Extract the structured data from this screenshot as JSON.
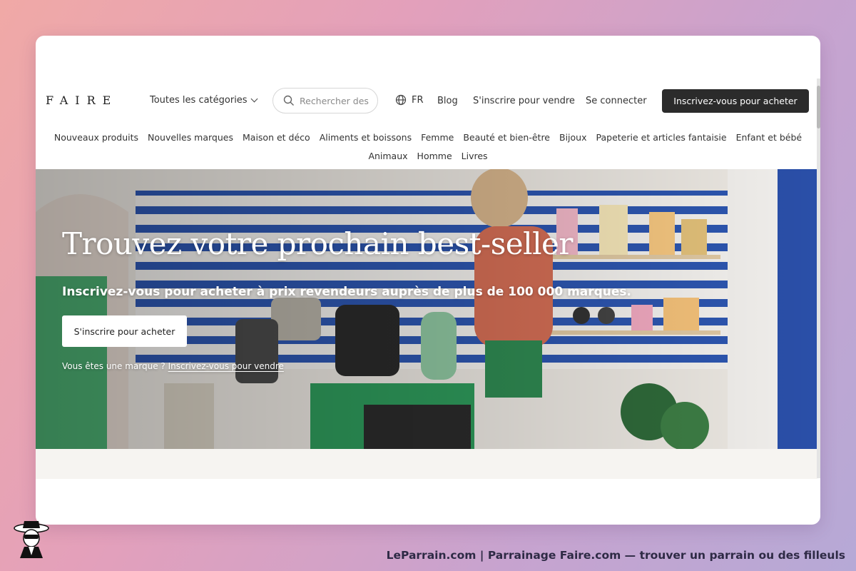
{
  "header": {
    "logo": "FAIRE",
    "categories_label": "Toutes les catégories",
    "search_placeholder": "Rechercher des",
    "language": "FR",
    "blog": "Blog",
    "sell_signup": "S'inscrire pour vendre",
    "login": "Se connecter",
    "buy_signup_button": "Inscrivez-vous pour acheter"
  },
  "category_nav": {
    "row1": [
      "Nouveaux produits",
      "Nouvelles marques",
      "Maison et déco",
      "Aliments et boissons",
      "Femme",
      "Beauté et bien-être",
      "Bijoux",
      "Papeterie et articles fantaisie",
      "Enfant et bébé"
    ],
    "row2": [
      "Animaux",
      "Homme",
      "Livres"
    ]
  },
  "hero": {
    "title": "Trouvez votre prochain best-seller",
    "subtitle": "Inscrivez-vous pour acheter à prix revendeurs auprès de plus de 100 000 marques.",
    "cta_button": "S'inscrire pour acheter",
    "brand_prefix": "Vous êtes une marque ?",
    "brand_link": "Inscrivez-vous pour vendre"
  },
  "footer_caption": "LeParrain.com | Parrainage Faire.com — trouver un parrain ou des filleuls",
  "colors": {
    "dark_button": "#2b2b2b",
    "hero_text": "#ffffff",
    "stripe_blue": "#2d56b0",
    "counter_green": "#2e9a5b",
    "caption_text": "#2e2a45"
  }
}
